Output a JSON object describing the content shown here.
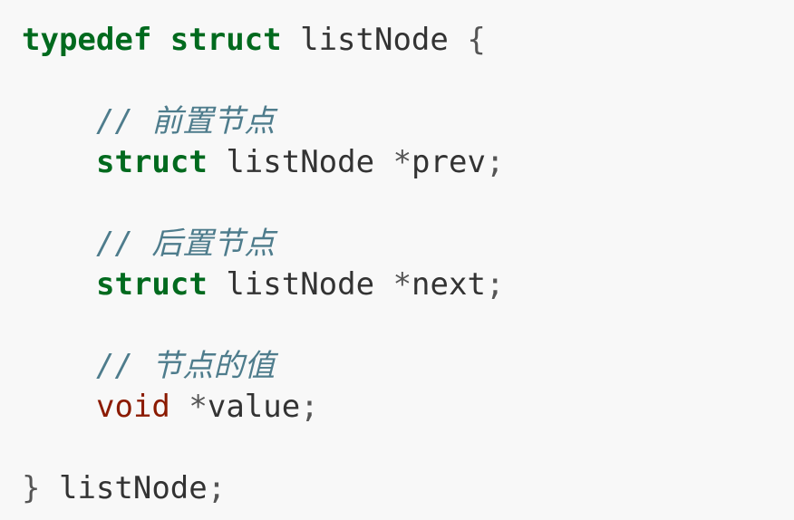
{
  "code": {
    "lines": [
      {
        "type": "open",
        "kw1": "typedef",
        "kw2": "struct",
        "name": "listNode",
        "brace": "{"
      },
      {
        "type": "blank"
      },
      {
        "type": "comment",
        "text": "// 前置节点"
      },
      {
        "type": "field",
        "kw": "struct",
        "typename": "listNode",
        "ptr": "*",
        "field": "prev",
        "semi": ";"
      },
      {
        "type": "blank"
      },
      {
        "type": "comment",
        "text": "// 后置节点"
      },
      {
        "type": "field",
        "kw": "struct",
        "typename": "listNode",
        "ptr": "*",
        "field": "next",
        "semi": ";"
      },
      {
        "type": "blank"
      },
      {
        "type": "comment",
        "text": "// 节点的值"
      },
      {
        "type": "field_void",
        "kw": "void",
        "ptr": "*",
        "field": "value",
        "semi": ";"
      },
      {
        "type": "blank"
      },
      {
        "type": "close",
        "brace": "}",
        "name": "listNode",
        "semi": ";"
      }
    ]
  },
  "colors": {
    "background": "#f8f8f8",
    "keyword": "#006a1e",
    "type_void": "#8b1a00",
    "comment": "#4e7c8c",
    "text": "#333333"
  }
}
